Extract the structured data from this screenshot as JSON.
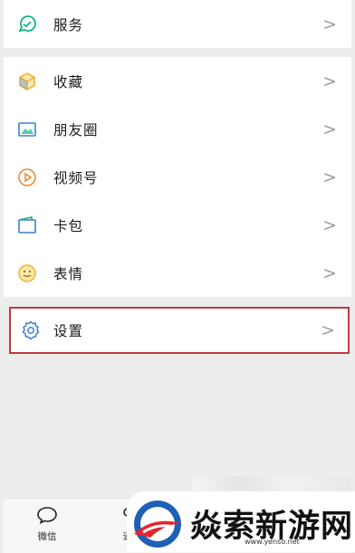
{
  "menu": {
    "services": {
      "label": "服务",
      "chevron": ">"
    },
    "favorites": {
      "label": "收藏",
      "chevron": ">"
    },
    "moments": {
      "label": "朋友圈",
      "chevron": ">"
    },
    "channels": {
      "label": "视频号",
      "chevron": ">"
    },
    "cards": {
      "label": "卡包",
      "chevron": ">"
    },
    "stickers": {
      "label": "表情",
      "chevron": ">"
    },
    "settings": {
      "label": "设置",
      "chevron": ">"
    }
  },
  "tabbar": {
    "chats": {
      "label": "微信",
      "icon": "chat-bubble-icon"
    },
    "contacts": {
      "label": "通",
      "icon": "contacts-icon"
    }
  },
  "watermark": {
    "text": "焱索新游网",
    "url": "www.yenso.net"
  },
  "colors": {
    "background": "#ededed",
    "highlight_border": "#c0393f",
    "icon_green": "#12b18a",
    "icon_yellow": "#f2b33d",
    "icon_blue": "#3b7fd6",
    "icon_orange": "#f08a32"
  }
}
